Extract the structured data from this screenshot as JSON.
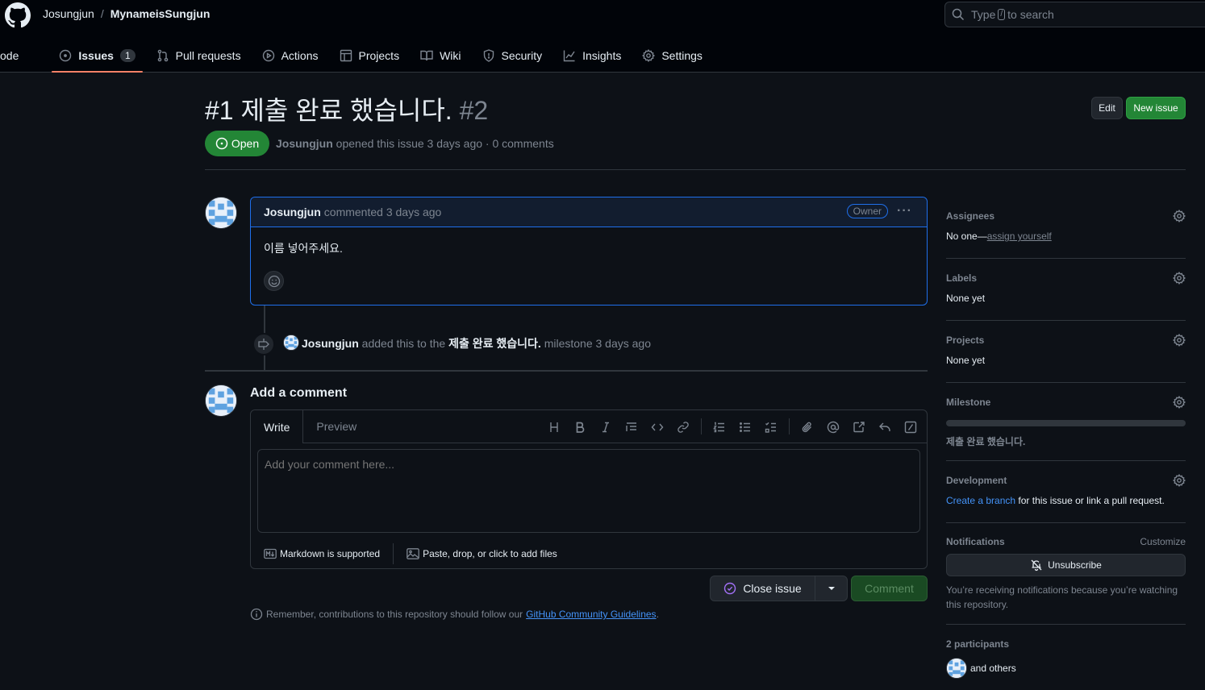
{
  "header": {
    "owner": "Josungjun",
    "separator": "/",
    "repo": "MynameisSungjun",
    "search_placeholder_pre": "Type",
    "search_key": "/",
    "search_placeholder_post": "to search"
  },
  "tabs": [
    {
      "label": "ode"
    },
    {
      "label": "Issues",
      "count": "1"
    },
    {
      "label": "Pull requests"
    },
    {
      "label": "Actions"
    },
    {
      "label": "Projects"
    },
    {
      "label": "Wiki"
    },
    {
      "label": "Security"
    },
    {
      "label": "Insights"
    },
    {
      "label": "Settings"
    }
  ],
  "issue": {
    "title": "#1 제출 완료 했습니다.",
    "number": "#2",
    "edit_label": "Edit",
    "new_issue_label": "New issue",
    "state": "Open",
    "author": "Josungjun",
    "meta_text": "opened this issue 3 days ago · 0 comments"
  },
  "comment": {
    "author": "Josungjun",
    "ago": "commented 3 days ago",
    "badge": "Owner",
    "body": "이름 넣어주세요."
  },
  "timeline_event": {
    "actor": "Josungjun",
    "text_pre": "added this to the",
    "milestone": "제출 완료 했습니다.",
    "text_post": "milestone 3 days ago"
  },
  "compose": {
    "title": "Add a comment",
    "tab_write": "Write",
    "tab_preview": "Preview",
    "placeholder": "Add your comment here...",
    "markdown_note": "Markdown is supported",
    "attach_note": "Paste, drop, or click to add files",
    "close_label": "Close issue",
    "comment_label": "Comment",
    "guidelines_pre": "Remember, contributions to this repository should follow our",
    "guidelines_link": "GitHub Community Guidelines",
    "guidelines_post": "."
  },
  "sidebar": {
    "assignees_title": "Assignees",
    "assignees_pre": "No one—",
    "assignees_link": "assign yourself",
    "labels_title": "Labels",
    "labels_value": "None yet",
    "projects_title": "Projects",
    "projects_value": "None yet",
    "milestone_title": "Milestone",
    "milestone_value": "제출 완료 했습니다.",
    "milestone_progress": 0,
    "development_title": "Development",
    "development_link": "Create a branch",
    "development_post": "for this issue or link a pull request.",
    "notifications_title": "Notifications",
    "customize": "Customize",
    "unsubscribe": "Unsubscribe",
    "notifications_note": "You’re receiving notifications because you’re watching this repository.",
    "participants_title": "2 participants",
    "participants_note": "and others"
  },
  "colors": {
    "accent_green": "#238636",
    "tab_underline": "#f78166",
    "link_blue": "#4493f8",
    "comment_border": "#1f6feb"
  }
}
